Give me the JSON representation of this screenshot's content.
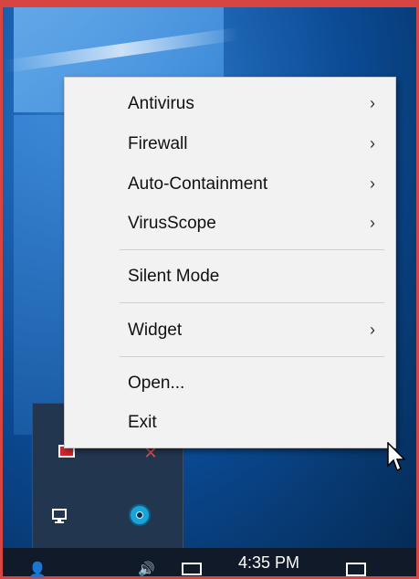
{
  "context_menu": {
    "items": [
      {
        "label": "Antivirus",
        "arrow": "›"
      },
      {
        "label": "Firewall",
        "arrow": "›"
      },
      {
        "label": "Auto-Containment",
        "arrow": "›"
      },
      {
        "label": "VirusScope",
        "arrow": "›"
      },
      {
        "label": "Silent Mode",
        "arrow": ""
      },
      {
        "label": "Widget",
        "arrow": "›"
      },
      {
        "label": "Open...",
        "arrow": ""
      },
      {
        "label": "Exit",
        "arrow": ""
      }
    ]
  },
  "taskbar": {
    "time": "4:35 PM"
  },
  "colors": {
    "frame_accent": "#d64541",
    "menu_bg": "#f2f2f2",
    "taskbar_bg": "#101a28"
  }
}
